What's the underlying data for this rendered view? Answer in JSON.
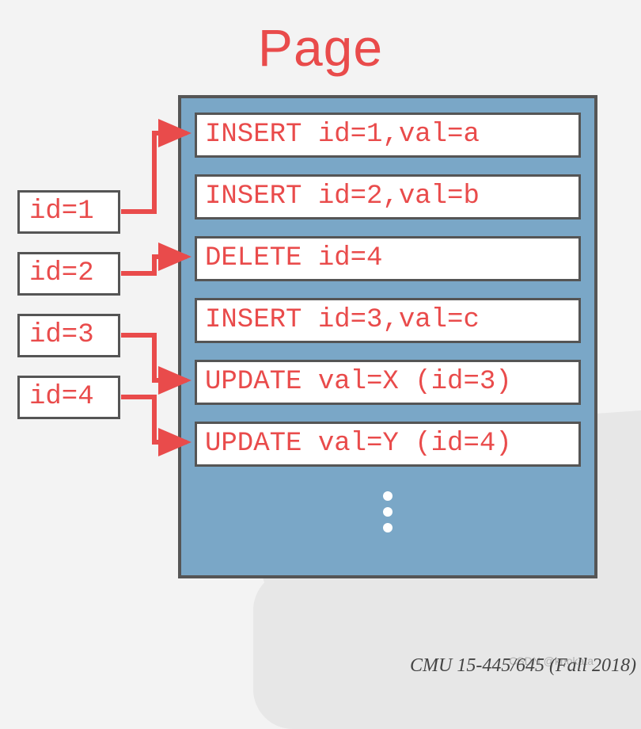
{
  "title": "Page",
  "index": {
    "items": [
      {
        "label": "id=1"
      },
      {
        "label": "id=2"
      },
      {
        "label": "id=3"
      },
      {
        "label": "id=4"
      }
    ]
  },
  "page": {
    "log": [
      {
        "text": "INSERT id=1,val=a"
      },
      {
        "text": "INSERT id=2,val=b"
      },
      {
        "text": "DELETE id=4"
      },
      {
        "text": "INSERT id=3,val=c"
      },
      {
        "text": "UPDATE val=X (id=3)"
      },
      {
        "text": "UPDATE val=Y (id=4)"
      }
    ]
  },
  "arrows": [
    {
      "from": 0,
      "to": 0
    },
    {
      "from": 1,
      "to": 2
    },
    {
      "from": 2,
      "to": 4
    },
    {
      "from": 3,
      "to": 5
    }
  ],
  "footer": "CMU 15-445/645 (Fall 2018)",
  "watermark": "CSDN @knokata",
  "colors": {
    "accent": "#e94b4b",
    "page_bg": "#7aa7c7",
    "border": "#555"
  }
}
